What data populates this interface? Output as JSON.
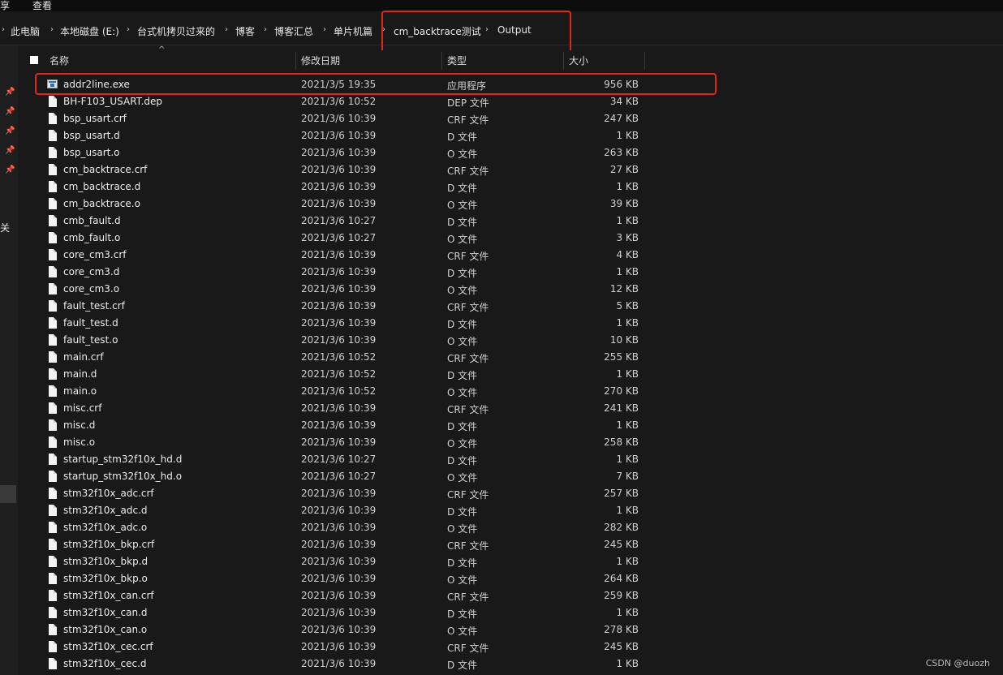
{
  "ribbon": {
    "tab_share": "享",
    "tab_view": "查看"
  },
  "breadcrumb": [
    "此电脑",
    "本地磁盘 (E:)",
    "台式机拷贝过来的",
    "博客",
    "博客汇总",
    "单片机篇",
    "cm_backtrace测试",
    "Output"
  ],
  "nav": {
    "partial_label": "关"
  },
  "columns": {
    "name": "名称",
    "date": "修改日期",
    "type": "类型",
    "size": "大小"
  },
  "files": [
    {
      "name": "addr2line.exe",
      "date": "2021/3/5 19:35",
      "type": "应用程序",
      "size": "956 KB",
      "icon": "exe-icon"
    },
    {
      "name": "BH-F103_USART.dep",
      "date": "2021/3/6 10:52",
      "type": "DEP 文件",
      "size": "34 KB",
      "icon": "file-icon"
    },
    {
      "name": "bsp_usart.crf",
      "date": "2021/3/6 10:39",
      "type": "CRF 文件",
      "size": "247 KB",
      "icon": "file-icon"
    },
    {
      "name": "bsp_usart.d",
      "date": "2021/3/6 10:39",
      "type": "D 文件",
      "size": "1 KB",
      "icon": "file-icon"
    },
    {
      "name": "bsp_usart.o",
      "date": "2021/3/6 10:39",
      "type": "O 文件",
      "size": "263 KB",
      "icon": "file-icon"
    },
    {
      "name": "cm_backtrace.crf",
      "date": "2021/3/6 10:39",
      "type": "CRF 文件",
      "size": "27 KB",
      "icon": "file-icon"
    },
    {
      "name": "cm_backtrace.d",
      "date": "2021/3/6 10:39",
      "type": "D 文件",
      "size": "1 KB",
      "icon": "file-icon"
    },
    {
      "name": "cm_backtrace.o",
      "date": "2021/3/6 10:39",
      "type": "O 文件",
      "size": "39 KB",
      "icon": "file-icon"
    },
    {
      "name": "cmb_fault.d",
      "date": "2021/3/6 10:27",
      "type": "D 文件",
      "size": "1 KB",
      "icon": "file-icon"
    },
    {
      "name": "cmb_fault.o",
      "date": "2021/3/6 10:27",
      "type": "O 文件",
      "size": "3 KB",
      "icon": "file-icon"
    },
    {
      "name": "core_cm3.crf",
      "date": "2021/3/6 10:39",
      "type": "CRF 文件",
      "size": "4 KB",
      "icon": "file-icon"
    },
    {
      "name": "core_cm3.d",
      "date": "2021/3/6 10:39",
      "type": "D 文件",
      "size": "1 KB",
      "icon": "file-icon"
    },
    {
      "name": "core_cm3.o",
      "date": "2021/3/6 10:39",
      "type": "O 文件",
      "size": "12 KB",
      "icon": "file-icon"
    },
    {
      "name": "fault_test.crf",
      "date": "2021/3/6 10:39",
      "type": "CRF 文件",
      "size": "5 KB",
      "icon": "file-icon"
    },
    {
      "name": "fault_test.d",
      "date": "2021/3/6 10:39",
      "type": "D 文件",
      "size": "1 KB",
      "icon": "file-icon"
    },
    {
      "name": "fault_test.o",
      "date": "2021/3/6 10:39",
      "type": "O 文件",
      "size": "10 KB",
      "icon": "file-icon"
    },
    {
      "name": "main.crf",
      "date": "2021/3/6 10:52",
      "type": "CRF 文件",
      "size": "255 KB",
      "icon": "file-icon"
    },
    {
      "name": "main.d",
      "date": "2021/3/6 10:52",
      "type": "D 文件",
      "size": "1 KB",
      "icon": "file-icon"
    },
    {
      "name": "main.o",
      "date": "2021/3/6 10:52",
      "type": "O 文件",
      "size": "270 KB",
      "icon": "file-icon"
    },
    {
      "name": "misc.crf",
      "date": "2021/3/6 10:39",
      "type": "CRF 文件",
      "size": "241 KB",
      "icon": "file-icon"
    },
    {
      "name": "misc.d",
      "date": "2021/3/6 10:39",
      "type": "D 文件",
      "size": "1 KB",
      "icon": "file-icon"
    },
    {
      "name": "misc.o",
      "date": "2021/3/6 10:39",
      "type": "O 文件",
      "size": "258 KB",
      "icon": "file-icon"
    },
    {
      "name": "startup_stm32f10x_hd.d",
      "date": "2021/3/6 10:27",
      "type": "D 文件",
      "size": "1 KB",
      "icon": "file-icon"
    },
    {
      "name": "startup_stm32f10x_hd.o",
      "date": "2021/3/6 10:27",
      "type": "O 文件",
      "size": "7 KB",
      "icon": "file-icon"
    },
    {
      "name": "stm32f10x_adc.crf",
      "date": "2021/3/6 10:39",
      "type": "CRF 文件",
      "size": "257 KB",
      "icon": "file-icon"
    },
    {
      "name": "stm32f10x_adc.d",
      "date": "2021/3/6 10:39",
      "type": "D 文件",
      "size": "1 KB",
      "icon": "file-icon"
    },
    {
      "name": "stm32f10x_adc.o",
      "date": "2021/3/6 10:39",
      "type": "O 文件",
      "size": "282 KB",
      "icon": "file-icon"
    },
    {
      "name": "stm32f10x_bkp.crf",
      "date": "2021/3/6 10:39",
      "type": "CRF 文件",
      "size": "245 KB",
      "icon": "file-icon"
    },
    {
      "name": "stm32f10x_bkp.d",
      "date": "2021/3/6 10:39",
      "type": "D 文件",
      "size": "1 KB",
      "icon": "file-icon"
    },
    {
      "name": "stm32f10x_bkp.o",
      "date": "2021/3/6 10:39",
      "type": "O 文件",
      "size": "264 KB",
      "icon": "file-icon"
    },
    {
      "name": "stm32f10x_can.crf",
      "date": "2021/3/6 10:39",
      "type": "CRF 文件",
      "size": "259 KB",
      "icon": "file-icon"
    },
    {
      "name": "stm32f10x_can.d",
      "date": "2021/3/6 10:39",
      "type": "D 文件",
      "size": "1 KB",
      "icon": "file-icon"
    },
    {
      "name": "stm32f10x_can.o",
      "date": "2021/3/6 10:39",
      "type": "O 文件",
      "size": "278 KB",
      "icon": "file-icon"
    },
    {
      "name": "stm32f10x_cec.crf",
      "date": "2021/3/6 10:39",
      "type": "CRF 文件",
      "size": "245 KB",
      "icon": "file-icon"
    },
    {
      "name": "stm32f10x_cec.d",
      "date": "2021/3/6 10:39",
      "type": "D 文件",
      "size": "1 KB",
      "icon": "file-icon"
    }
  ],
  "watermark": "CSDN @duozh",
  "colors": {
    "background": "#191919",
    "highlight": "#e0261d",
    "text": "#e6e6e6"
  }
}
